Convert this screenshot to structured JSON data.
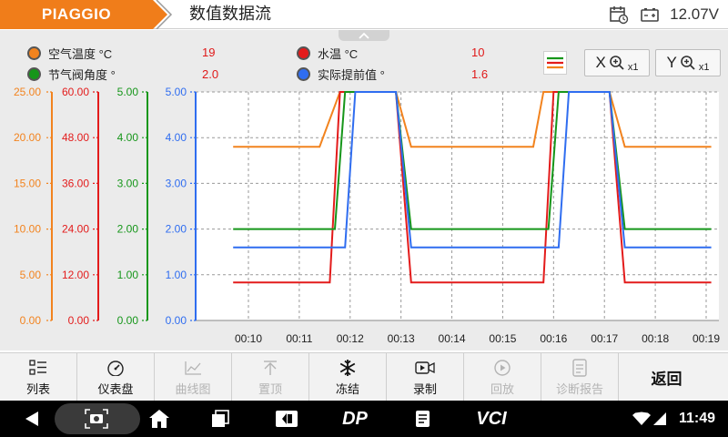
{
  "header": {
    "brand": "PIAGGIO",
    "title": "数值数据流",
    "voltage": "12.07V",
    "icons": [
      "calendar-clock-icon",
      "battery-icon"
    ]
  },
  "legend": [
    {
      "name": "空气温度 °C",
      "value": "19",
      "color": "#f2831e"
    },
    {
      "name": "水温 °C",
      "value": "10",
      "color": "#e31b1b"
    },
    {
      "name": "节气阀角度 °",
      "value": "2.0",
      "color": "#16961a"
    },
    {
      "name": "实际提前值 °",
      "value": "1.6",
      "color": "#2f6df0"
    }
  ],
  "zoom": {
    "x_label": "X",
    "y_label": "Y",
    "x_factor": "x1",
    "y_factor": "x1"
  },
  "chart_data": {
    "type": "line",
    "x_ticks": [
      "00:10",
      "00:11",
      "00:12",
      "00:13",
      "00:14",
      "00:15",
      "00:16",
      "00:17",
      "00:18",
      "00:19"
    ],
    "axes": [
      {
        "series": "空气温度 °C",
        "color": "#f2831e",
        "ticks": [
          "25.00",
          "20.00",
          "15.00",
          "10.00",
          "5.00",
          "0.00"
        ],
        "ylim": [
          0,
          25
        ]
      },
      {
        "series": "水温 °C",
        "color": "#e31b1b",
        "ticks": [
          "60.00",
          "48.00",
          "36.00",
          "24.00",
          "12.00",
          "0.00"
        ],
        "ylim": [
          0,
          60
        ]
      },
      {
        "series": "节气阀角度 °",
        "color": "#16961a",
        "ticks": [
          "5.00",
          "4.00",
          "3.00",
          "2.00",
          "1.00",
          "0.00"
        ],
        "ylim": [
          0,
          5
        ]
      },
      {
        "series": "实际提前值 °",
        "color": "#2f6df0",
        "ticks": [
          "5.00",
          "4.00",
          "3.00",
          "2.00",
          "1.00",
          "0.00"
        ],
        "ylim": [
          0,
          5
        ]
      }
    ],
    "series": [
      {
        "name": "空气温度 °C",
        "color": "#f2831e",
        "axis": 0,
        "points": [
          [
            "00:09.7",
            19
          ],
          [
            "00:11.4",
            19
          ],
          [
            "00:11.8",
            25
          ],
          [
            "00:12.9",
            25
          ],
          [
            "00:13.2",
            19
          ],
          [
            "00:15.6",
            19
          ],
          [
            "00:15.8",
            25
          ],
          [
            "00:17.1",
            25
          ],
          [
            "00:17.4",
            19
          ],
          [
            "00:19.1",
            19
          ]
        ]
      },
      {
        "name": "水温 °C",
        "color": "#e31b1b",
        "axis": 1,
        "points": [
          [
            "00:09.7",
            10
          ],
          [
            "00:11.6",
            10
          ],
          [
            "00:11.8",
            60
          ],
          [
            "00:12.9",
            60
          ],
          [
            "00:13.2",
            10
          ],
          [
            "00:15.8",
            10
          ],
          [
            "00:16.0",
            60
          ],
          [
            "00:17.1",
            60
          ],
          [
            "00:17.4",
            10
          ],
          [
            "00:19.1",
            10
          ]
        ]
      },
      {
        "name": "节气阀角度 °",
        "color": "#16961a",
        "axis": 2,
        "points": [
          [
            "00:09.7",
            2.0
          ],
          [
            "00:11.7",
            2.0
          ],
          [
            "00:11.9",
            5.0
          ],
          [
            "00:12.9",
            5.0
          ],
          [
            "00:13.2",
            2.0
          ],
          [
            "00:15.9",
            2.0
          ],
          [
            "00:16.1",
            5.0
          ],
          [
            "00:17.1",
            5.0
          ],
          [
            "00:17.4",
            2.0
          ],
          [
            "00:19.1",
            2.0
          ]
        ]
      },
      {
        "name": "实际提前值 °",
        "color": "#2f6df0",
        "axis": 3,
        "points": [
          [
            "00:09.7",
            1.6
          ],
          [
            "00:11.9",
            1.6
          ],
          [
            "00:12.1",
            5.0
          ],
          [
            "00:12.9",
            5.0
          ],
          [
            "00:13.2",
            1.6
          ],
          [
            "00:16.1",
            1.6
          ],
          [
            "00:16.3",
            5.0
          ],
          [
            "00:17.1",
            5.0
          ],
          [
            "00:17.4",
            1.6
          ],
          [
            "00:19.1",
            1.6
          ]
        ]
      }
    ],
    "grid": true,
    "legend_position": "top-left"
  },
  "toolbar": {
    "buttons": [
      {
        "label": "列表",
        "icon": "list-icon",
        "enabled": true
      },
      {
        "label": "仪表盘",
        "icon": "gauge-icon",
        "enabled": true
      },
      {
        "label": "曲线图",
        "icon": "line-chart-icon",
        "enabled": false
      },
      {
        "label": "置顶",
        "icon": "pin-top-icon",
        "enabled": false
      },
      {
        "label": "冻结",
        "icon": "snowflake-icon",
        "enabled": true
      },
      {
        "label": "录制",
        "icon": "record-icon",
        "enabled": true
      },
      {
        "label": "回放",
        "icon": "playback-icon",
        "enabled": false
      },
      {
        "label": "诊断报告",
        "icon": "report-icon",
        "enabled": false
      }
    ],
    "back_label": "返回"
  },
  "navbar": {
    "time": "11:49",
    "icons": [
      "back-icon",
      "screenshot-icon",
      "home-icon",
      "recents-icon",
      "remote-icon",
      "dp-icon",
      "notes-icon",
      "vci-icon",
      "wifi-icon",
      "signal-icon"
    ],
    "dp_label": "DP",
    "vci_label": "VCI"
  }
}
